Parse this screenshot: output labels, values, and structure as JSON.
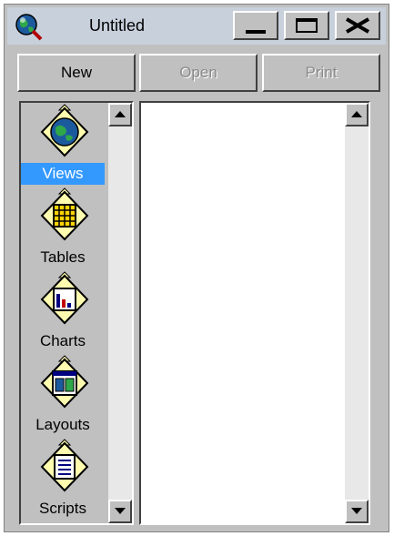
{
  "window": {
    "title": "Untitled"
  },
  "toolbar": {
    "new_label": "New",
    "open_label": "Open",
    "print_label": "Print"
  },
  "doc_types": [
    {
      "label": "Views",
      "icon": "globe-icon",
      "selected": true
    },
    {
      "label": "Tables",
      "icon": "table-grid-icon",
      "selected": false
    },
    {
      "label": "Charts",
      "icon": "bar-chart-icon",
      "selected": false
    },
    {
      "label": "Layouts",
      "icon": "layout-icon",
      "selected": false
    },
    {
      "label": "Scripts",
      "icon": "script-icon",
      "selected": false
    }
  ],
  "colors": {
    "selection": "#3399ff",
    "face": "#c0c0c0",
    "title_bg": "#c8d0dc"
  }
}
